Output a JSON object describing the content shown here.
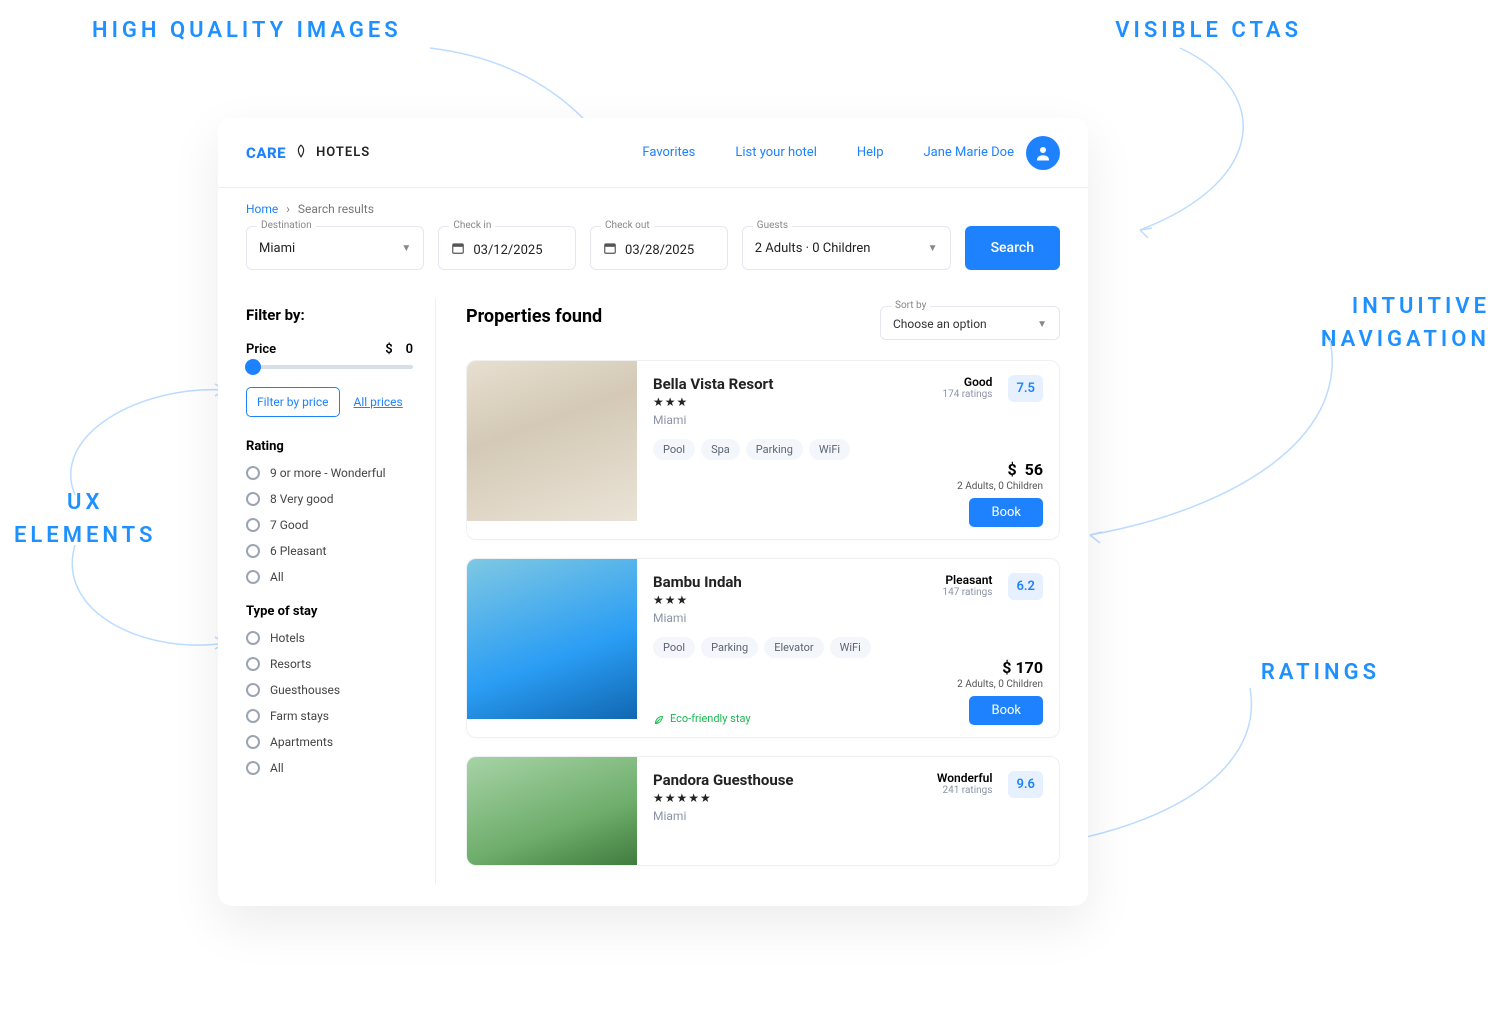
{
  "callouts": {
    "images": "HIGH QUALITY IMAGES",
    "ctas": "VISIBLE CTAS",
    "ux": "UX ELEMENTS",
    "nav": "INTUITIVE NAVIGATION",
    "ratings": "RATINGS"
  },
  "brand": {
    "care": "CARE",
    "hotels": "HOTELS"
  },
  "nav": {
    "favorites": "Favorites",
    "list": "List your hotel",
    "help": "Help"
  },
  "user": {
    "name": "Jane Marie Doe"
  },
  "crumbs": {
    "home": "Home",
    "current": "Search results"
  },
  "search": {
    "destination_label": "Destination",
    "destination": "Miami",
    "checkin_label": "Check in",
    "checkin": "03/12/2025",
    "checkout_label": "Check out",
    "checkout": "03/28/2025",
    "guests_label": "Guests",
    "guests": "2  Adults   ·   0  Children",
    "button": "Search"
  },
  "filters": {
    "title": "Filter by:",
    "price_label": "Price",
    "currency": "$",
    "price_value": "0",
    "btn_filter": "Filter by price",
    "link_all": "All prices",
    "rating_title": "Rating",
    "rating_options": [
      "9 or more -  Wonderful",
      "8 Very good",
      "7 Good",
      "6 Pleasant",
      "All"
    ],
    "stay_title": "Type of stay",
    "stay_options": [
      "Hotels",
      "Resorts",
      "Guesthouses",
      "Farm stays",
      "Apartments",
      "All"
    ]
  },
  "results": {
    "title": "Properties found",
    "sort_label": "Sort by",
    "sort_value": "Choose an option"
  },
  "cards": [
    {
      "name": "Bella Vista Resort",
      "stars": "★★★",
      "city": "Miami",
      "amenities": [
        "Pool",
        "Spa",
        "Parking",
        "WiFi"
      ],
      "rating_label": "Good",
      "rating_count": "174 ratings",
      "rating_score": "7.5",
      "price_currency": "$",
      "price": "56",
      "pax": "2 Adults,  0 Children",
      "book": "Book",
      "eco": ""
    },
    {
      "name": "Bambu Indah",
      "stars": "★★★",
      "city": "Miami",
      "amenities": [
        "Pool",
        "Parking",
        "Elevator",
        "WiFi"
      ],
      "rating_label": "Pleasant",
      "rating_count": "147 ratings",
      "rating_score": "6.2",
      "price_currency": "$",
      "price": "170",
      "pax": "2 Adults,  0 Children",
      "book": "Book",
      "eco": "Eco-friendly stay"
    },
    {
      "name": "Pandora Guesthouse",
      "stars": "★★★★★",
      "city": "Miami",
      "amenities": [],
      "rating_label": "Wonderful",
      "rating_count": "241  ratings",
      "rating_score": "9.6",
      "price_currency": "",
      "price": "",
      "pax": "",
      "book": "",
      "eco": ""
    }
  ]
}
